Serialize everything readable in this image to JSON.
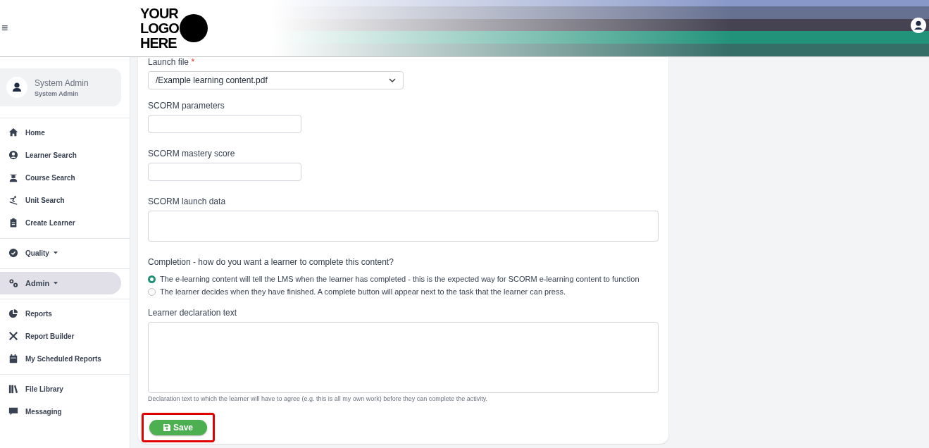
{
  "header": {
    "menu_glyph": "≡",
    "logo_lines": [
      "YOUR",
      "LOGO",
      "HERE"
    ]
  },
  "user_card": {
    "name": "System Admin",
    "role": "System Admin"
  },
  "sidebar": {
    "groups": [
      {
        "items": [
          {
            "label": "Home",
            "selected": false,
            "caret": false
          },
          {
            "label": "Learner Search",
            "selected": false,
            "caret": false
          },
          {
            "label": "Course Search",
            "selected": false,
            "caret": false
          },
          {
            "label": "Unit Search",
            "selected": false,
            "caret": false
          },
          {
            "label": "Create Learner",
            "selected": false,
            "caret": false
          }
        ]
      },
      {
        "items": [
          {
            "label": "Quality",
            "selected": false,
            "caret": true
          }
        ]
      },
      {
        "items": [
          {
            "label": "Admin",
            "selected": true,
            "caret": true
          }
        ]
      },
      {
        "items": [
          {
            "label": "Reports",
            "selected": false,
            "caret": false
          },
          {
            "label": "Report Builder",
            "selected": false,
            "caret": false
          },
          {
            "label": "My Scheduled Reports",
            "selected": false,
            "caret": false
          }
        ]
      },
      {
        "items": [
          {
            "label": "File Library",
            "selected": false,
            "caret": false
          },
          {
            "label": "Messaging",
            "selected": false,
            "caret": false
          }
        ]
      }
    ]
  },
  "form": {
    "launch_file": {
      "label": "Launch file",
      "required_mark": "*",
      "value": "/Example learning content.pdf"
    },
    "fields": [
      {
        "label": "SCORM parameters",
        "kind": "short"
      },
      {
        "label": "SCORM mastery score",
        "kind": "short"
      },
      {
        "label": "SCORM launch data",
        "kind": "wide"
      }
    ],
    "completion": {
      "question": "Completion - how do you want a learner to complete this content?",
      "options": [
        {
          "label": "The e-learning content will tell the LMS when the learner has completed - this is the expected way for SCORM e-learning content to function",
          "selected": true
        },
        {
          "label": "The learner decides when they have finished. A complete button will appear next to the task that the learner can press.",
          "selected": false
        }
      ]
    },
    "declaration": {
      "label": "Learner declaration text",
      "help": "Declaration text to which the learner will have to agree (e.g. this is all my own work) before they can complete the activity."
    },
    "save_button": {
      "label": "Save",
      "highlighted": true
    }
  }
}
